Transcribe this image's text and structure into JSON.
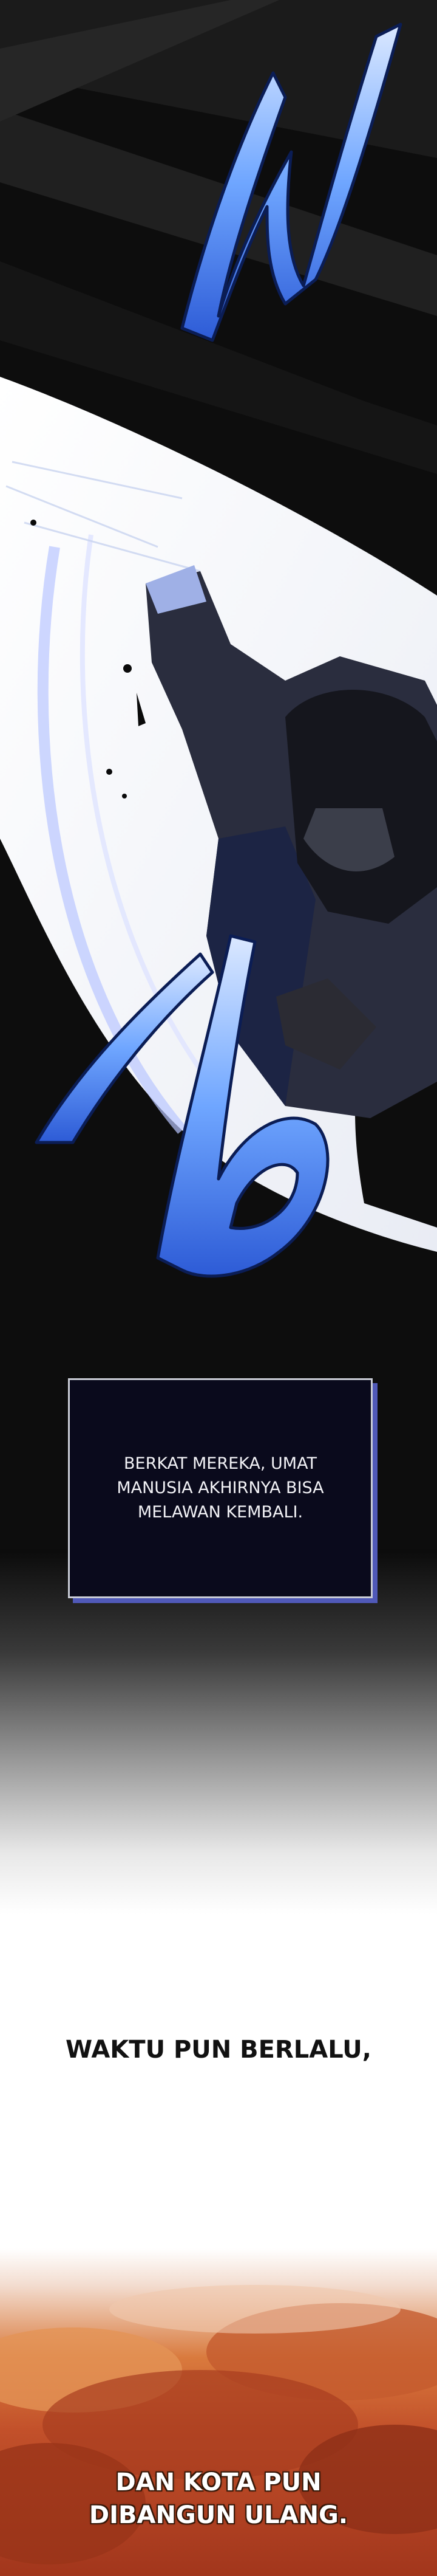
{
  "panels": {
    "attack_panel": {
      "sfx_top": "",
      "sfx_bottom": ""
    },
    "narration_box": {
      "text": "BERKAT MEREKA, UMAT\nMANUSIA AKHIRNYA BISA\nMELAWAN KEMBALI."
    },
    "caption_1": {
      "text": "WAKTU PUN BERLALU,"
    },
    "caption_2": {
      "text": "DAN KOTA PUN\nDIBANGUN ULANG."
    }
  },
  "colors": {
    "panel_dark": "#0b0b0b",
    "sfx_blue": "#6fa6ff",
    "narration_bg": "#0a0a1c",
    "narration_shadow": "#5059b8",
    "fire_orange": "#d97a3d"
  }
}
